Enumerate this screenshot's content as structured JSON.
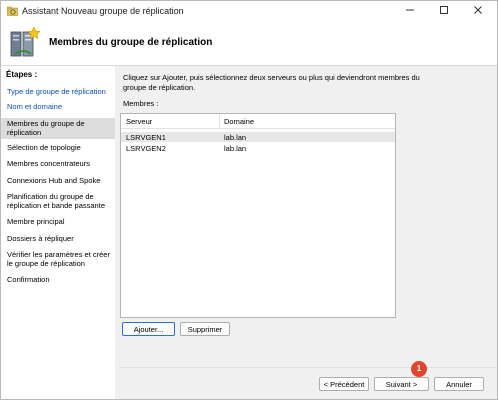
{
  "window": {
    "title": "Assistant Nouveau groupe de réplication"
  },
  "header": {
    "title": "Membres du groupe de réplication"
  },
  "steps": {
    "heading": "Étapes :",
    "items": [
      {
        "label": "Type de groupe de réplication"
      },
      {
        "label": "Nom et domaine"
      },
      {
        "label": "Membres du groupe de réplication"
      },
      {
        "label": "Sélection de topologie"
      },
      {
        "label": "Membres concentrateurs"
      },
      {
        "label": "Connexions Hub and Spoke"
      },
      {
        "label": "Planification du groupe de réplication et bande passante"
      },
      {
        "label": "Membre principal"
      },
      {
        "label": "Dossiers à répliquer"
      },
      {
        "label": "Vérifier les paramètres et créer le groupe de réplication"
      },
      {
        "label": "Confirmation"
      }
    ]
  },
  "main": {
    "instruction": "Cliquez sur Ajouter, puis sélectionnez deux serveurs ou plus qui deviendront membres du groupe de réplication.",
    "members_label": "Membres :",
    "columns": [
      "Serveur",
      "Domaine"
    ],
    "rows": [
      {
        "server": "LSRVGEN1",
        "domain": "lab.lan"
      },
      {
        "server": "LSRVGEN2",
        "domain": "lab.lan"
      }
    ],
    "add_button": "Ajouter...",
    "remove_button": "Supprimer"
  },
  "footer": {
    "prev_button": "< Précédent",
    "next_button": "Suivant >",
    "cancel_button": "Annuler",
    "badge": "1"
  }
}
